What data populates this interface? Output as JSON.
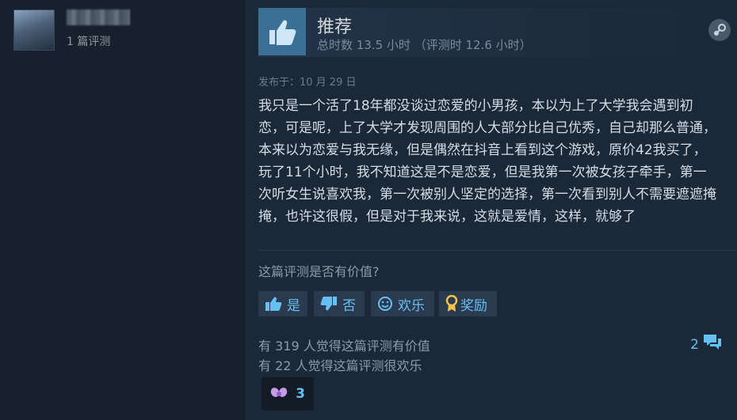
{
  "user": {
    "review_count": "1 篇评测"
  },
  "review": {
    "verdict": "推荐",
    "playtime": "总时数 13.5 小时 （评测时 12.6 小时）",
    "posted": "发布于：10 月 29 日",
    "body": "我只是一个活了18年都没谈过恋爱的小男孩，本以为上了大学我会遇到初恋，可是呢，上了大学才发现周围的人大部分比自己优秀，自己却那么普通，本来以为恋爱与我无缘，但是偶然在抖音上看到这个游戏，原价42我买了，玩了11个小时，我不知道这是不是恋爱，但是我第一次被女孩子牵手，第一次听女生说喜欢我，第一次被别人坚定的选择，第一次看到别人不需要遮遮掩掩，也许这很假，但是对于我来说，这就是爱情，这样，就够了"
  },
  "feedback": {
    "question": "这篇评测是否有价值?",
    "yes_label": "是",
    "no_label": "否",
    "funny_label": "欢乐",
    "award_label": "奖励"
  },
  "stats": {
    "helpful": "有 319 人觉得这篇评测有价值",
    "funny": "有 22 人觉得这篇评测很欢乐",
    "comments": "2",
    "awards": "3"
  },
  "icons": {
    "thumb": "thumbs-up-icon",
    "steam": "steam-logo-icon",
    "comment": "comment-bubble-icon",
    "award": "award-ribbon-icon",
    "funny": "smiley-icon",
    "wings": "winged-heart-icon"
  },
  "colors": {
    "accent": "#66c0f4",
    "thumb_bg": "#3c6f95",
    "page_bg": "#1b2838"
  }
}
